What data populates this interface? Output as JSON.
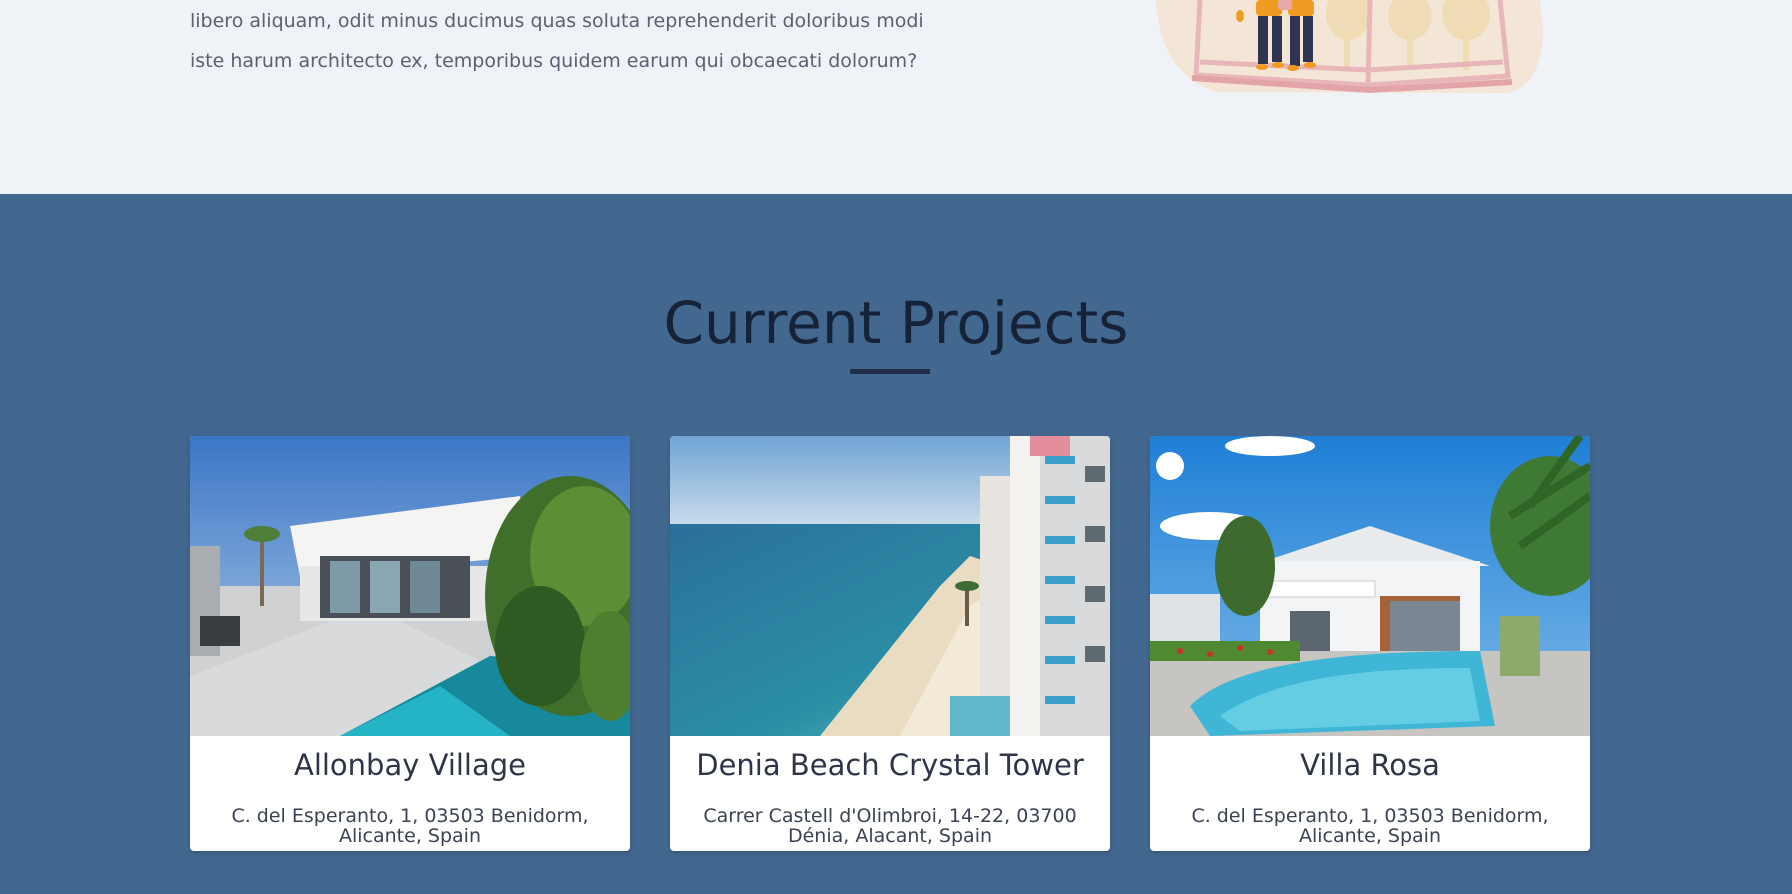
{
  "about": {
    "line1": "libero aliquam, odit minus ducimus quas soluta reprehenderit doloribus modi",
    "line2": "iste harum architecto ex, temporibus quidem earum qui obcaecati dolorum?"
  },
  "projects": {
    "title": "Current Projects",
    "cards": [
      {
        "name": "Allonbay Village",
        "address": "C. del Esperanto, 1, 03503 Benidorm, Alicante, Spain"
      },
      {
        "name": "Denia Beach Crystal Tower",
        "address": "Carrer Castell d'Olimbroi, 14-22, 03700 Dénia, Alacant, Spain"
      },
      {
        "name": "Villa Rosa",
        "address": "C. del Esperanto, 1, 03503 Benidorm, Alicante, Spain"
      }
    ]
  },
  "colors": {
    "about_bg": "#eff2f7",
    "projects_bg": "#436890",
    "title": "#152238",
    "card_bg": "#ffffff"
  }
}
